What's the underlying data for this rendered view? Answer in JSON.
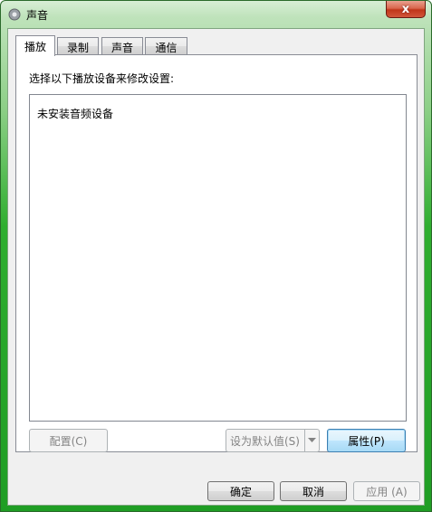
{
  "window": {
    "title": "声音",
    "close_label": "x"
  },
  "tabs": [
    {
      "label": "播放",
      "active": true
    },
    {
      "label": "录制",
      "active": false
    },
    {
      "label": "声音",
      "active": false
    },
    {
      "label": "通信",
      "active": false
    }
  ],
  "playback": {
    "instruction": "选择以下播放设备来修改设置:",
    "empty_message": "未安装音频设备",
    "configure_button": "配置(C)",
    "set_default_button": "设为默认值(S)",
    "properties_button": "属性(P)"
  },
  "footer": {
    "ok_button": "确定",
    "cancel_button": "取消",
    "apply_button": "应用 (A)"
  },
  "icons": {
    "title": "speaker-icon",
    "dropdown": "chevron-down-icon"
  },
  "colors": {
    "frame_green": "#1f9d24",
    "close_red": "#c0351a",
    "primary_border": "#3c7fb1"
  }
}
